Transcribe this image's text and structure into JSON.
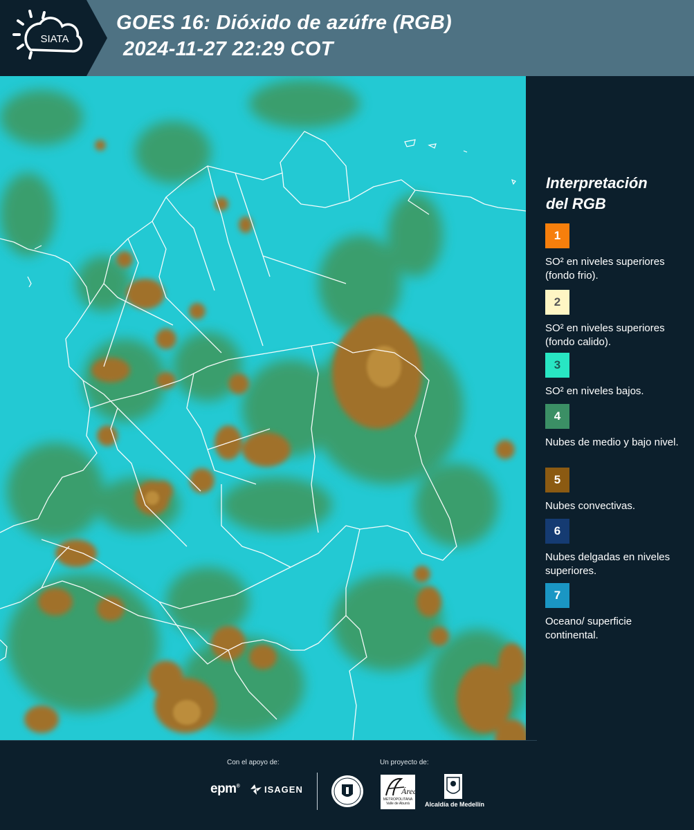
{
  "header": {
    "logo_text": "SIATA",
    "title_line1": "GOES 16: Dióxido de azúfre (RGB)",
    "title_line2": "2024-11-27 22:29 COT",
    "background_color": "#4e7283"
  },
  "legend": {
    "title_line1": "Interpretación",
    "title_line2": "del RGB",
    "items": [
      {
        "number": "1",
        "label": "SO² en niveles superiores (fondo frio).",
        "color": "#f77f0c",
        "text_color": "#ffffff"
      },
      {
        "number": "2",
        "label": "SO² en niveles superiores (fondo calido).",
        "color": "#fff6c4",
        "text_color": "#555555"
      },
      {
        "number": "3",
        "label": "SO² en niveles bajos.",
        "color": "#28e6c3",
        "text_color": "#1a5a55"
      },
      {
        "number": "4",
        "label": "Nubes de medio y bajo nivel.",
        "color": "#3b8f65",
        "text_color": "#ffffff"
      },
      {
        "number": "5",
        "label": "Nubes convectivas.",
        "color": "#8b5a12",
        "text_color": "#ffffff"
      },
      {
        "number": "6",
        "label": "Nubes delgadas en niveles superiores.",
        "color": "#153b72",
        "text_color": "#ffffff"
      },
      {
        "number": "7",
        "label": "Oceano/ superficie continental.",
        "color": "#1a96c4",
        "text_color": "#ffffff"
      }
    ]
  },
  "map": {
    "icon": "satellite-map-image",
    "colors": {
      "background": "#22c8d2",
      "green": "#3a9a62",
      "convective": "#9c6e2a",
      "border": "#ffffff"
    }
  },
  "footer": {
    "support_label": "Con el apoyo de:",
    "project_label": "Un proyecto de:",
    "epm": "epm",
    "isagen": "ISAGEN",
    "area_name": "Área",
    "area_sub": "METROPOLITANA Valle de Aburrá",
    "alcaldia": "Alcaldía de Medellín"
  }
}
